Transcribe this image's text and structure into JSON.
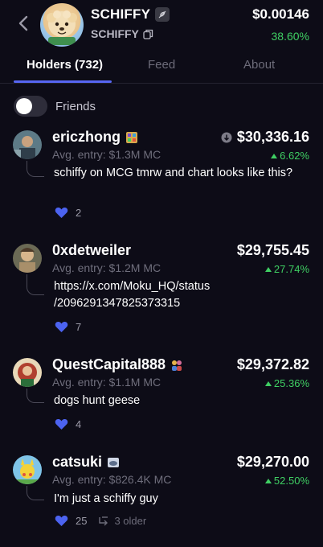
{
  "header": {
    "token_name": "SCHIFFY",
    "ticker": "SCHIFFY",
    "price": "$0.00146",
    "change": "38.60%"
  },
  "tabs": [
    {
      "label": "Holders (732)"
    },
    {
      "label": "Feed"
    },
    {
      "label": "About"
    }
  ],
  "friends_toggle": {
    "label": "Friends",
    "on": false
  },
  "holders": [
    {
      "name": "ericzhong",
      "entry": "Avg. entry: $1.3M MC",
      "value": "$30,336.16",
      "pct": "6.62%",
      "message": "schiffy on MCG tmrw and chart looks like this?",
      "likes": "2"
    },
    {
      "name": "0xdetweiler",
      "entry": "Avg. entry: $1.2M MC",
      "value": "$29,755.45",
      "pct": "27.74%",
      "message": "https://x.com/Moku_HQ/status /2096291347825373315",
      "likes": "7"
    },
    {
      "name": "QuestCapital888",
      "entry": "Avg. entry: $1.1M MC",
      "value": "$29,372.82",
      "pct": "25.36%",
      "message": "dogs hunt geese",
      "likes": "4"
    },
    {
      "name": "catsuki",
      "entry": "Avg. entry: $826.4K MC",
      "value": "$29,270.00",
      "pct": "52.50%",
      "message": "I'm just a schiffy guy",
      "likes": "25",
      "older": "3 older"
    }
  ],
  "colors": {
    "accent": "#5766f2",
    "positive": "#3fcf63",
    "background": "#0d0c17"
  }
}
